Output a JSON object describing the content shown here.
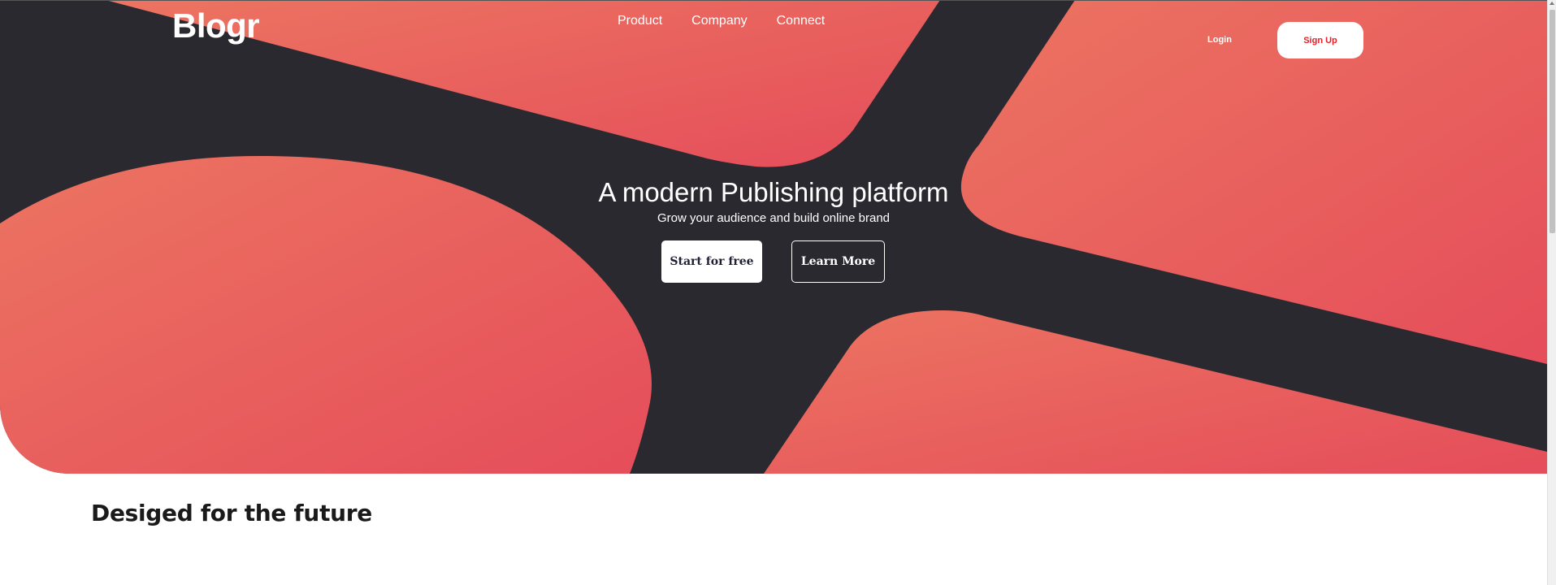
{
  "brand": {
    "logo": "Blogr"
  },
  "nav": {
    "items": [
      {
        "label": "Product"
      },
      {
        "label": "Company"
      },
      {
        "label": "Connect"
      }
    ],
    "login_label": "Login",
    "signup_label": "Sign Up"
  },
  "hero": {
    "headline": "A modern Publishing platform",
    "subline": "Grow your audience and build online brand",
    "start_label": "Start for free",
    "learn_label": "Learn More"
  },
  "section": {
    "title": "Desiged for the future"
  },
  "colors": {
    "hero_dark": "#2a2930",
    "gradient_start": "#ec7461",
    "gradient_end": "#e54d5a",
    "signup_text": "#e5202a",
    "start_text": "#1f2133"
  }
}
